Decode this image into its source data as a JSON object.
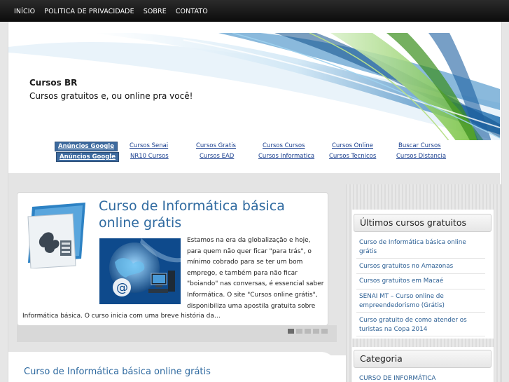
{
  "nav": {
    "items": [
      {
        "label": "INÍCIO"
      },
      {
        "label": "POLITICA DE PRIVACIDADE"
      },
      {
        "label": "SOBRE"
      },
      {
        "label": "CONTATO"
      }
    ]
  },
  "header": {
    "site_title": "Cursos BR",
    "site_description": "Cursos gratuitos e, ou online pra você!"
  },
  "ads": {
    "badge_label": "Anúncios Google",
    "row1": [
      "Cursos Senai",
      "Cursos Gratis",
      "Cursos Cursos",
      "Cursos Online",
      "Buscar Cursos"
    ],
    "row2": [
      "NR10 Cursos",
      "Cursos EAD",
      "Cursos Informatica",
      "Cursos Tecnicos",
      "Cursos Distancia"
    ]
  },
  "featured": {
    "title_line1": "Curso de Informática básica",
    "title_line2": "online grátis",
    "excerpt_lines": [
      "Estamos na era da globalização e hoje,",
      "para quem não quer ficar \"para trás\", o",
      "mínimo cobrado para se ter um bom",
      "emprego, e também para não ficar",
      "\"boiando\" nas conversas, é essencial saber",
      "Informática. O site \"Cursos online grátis\",",
      "disponibiliza uma apostila gratuita sobre"
    ],
    "excerpt_tail": "Informática básica. O curso inicia com uma breve história da…",
    "slides_active": 1
  },
  "second_post": {
    "title": "Curso de Informática básica online grátis"
  },
  "sidebar": {
    "latest_title": "Últimos cursos gratuitos",
    "latest_items": [
      {
        "line1": "Curso de Informática básica online",
        "line2": "grátis"
      },
      {
        "line1": "Cursos gratuitos no Amazonas",
        "line2": ""
      },
      {
        "line1": "Cursos gratuitos em Macaé",
        "line2": ""
      },
      {
        "line1": "SENAI MT – Curso online de",
        "line2": "empreendedorismo (Grátis)"
      },
      {
        "line1": "Curso gratuito de como atender os",
        "line2": "turistas na Copa 2014"
      }
    ],
    "category_title": "Categoria",
    "category_items": [
      "CURSO DE INFORMÁTICA"
    ]
  },
  "colors": {
    "link": "#2f6aa0",
    "nav_bg": "#1a1a1a",
    "ad_badge": "#3d6a9e"
  }
}
